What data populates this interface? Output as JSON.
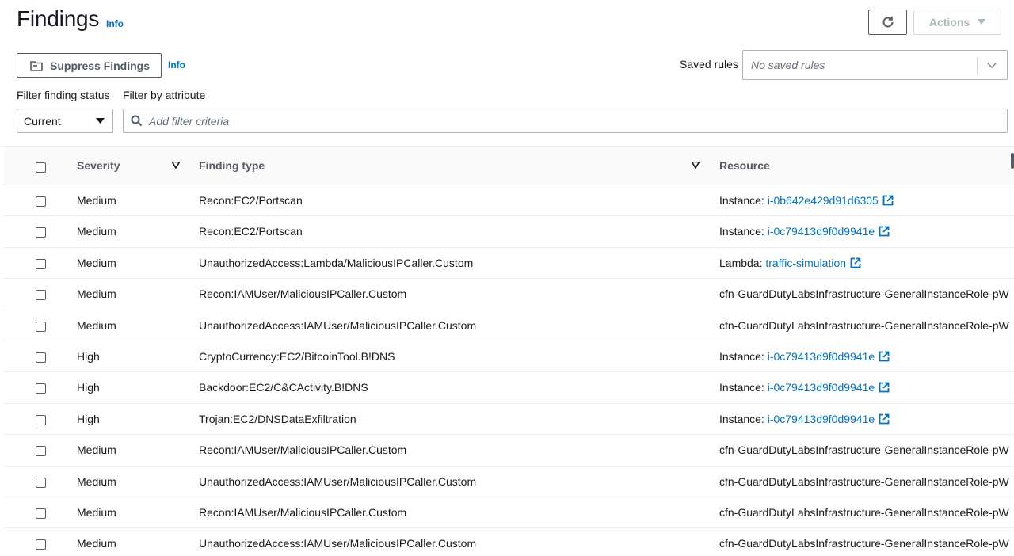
{
  "header": {
    "title": "Findings",
    "info_label": "Info",
    "actions_label": "Actions"
  },
  "toolbar": {
    "suppress_label": "Suppress Findings",
    "info_label": "Info",
    "saved_rules_label": "Saved rules",
    "saved_rules_placeholder": "No saved rules"
  },
  "filters": {
    "status_label": "Filter finding status",
    "attribute_label": "Filter by attribute",
    "status_value": "Current",
    "criteria_placeholder": "Add filter criteria"
  },
  "table": {
    "columns": [
      "Severity",
      "Finding type",
      "Resource"
    ],
    "rows": [
      {
        "severity": "Medium",
        "type": "Recon:EC2/Portscan",
        "res_prefix": "Instance: ",
        "res_link": "i-0b642e429d91d6305",
        "external": true
      },
      {
        "severity": "Medium",
        "type": "Recon:EC2/Portscan",
        "res_prefix": "Instance: ",
        "res_link": "i-0c79413d9f0d9941e",
        "external": true
      },
      {
        "severity": "Medium",
        "type": "UnauthorizedAccess:Lambda/MaliciousIPCaller.Custom",
        "res_prefix": "Lambda: ",
        "res_link": "traffic-simulation",
        "external": true
      },
      {
        "severity": "Medium",
        "type": "Recon:IAMUser/MaliciousIPCaller.Custom",
        "res_prefix": "cfn-GuardDutyLabsInfrastructure-GeneralInstanceRole-pW",
        "res_link": "",
        "external": false
      },
      {
        "severity": "Medium",
        "type": "UnauthorizedAccess:IAMUser/MaliciousIPCaller.Custom",
        "res_prefix": "cfn-GuardDutyLabsInfrastructure-GeneralInstanceRole-pW",
        "res_link": "",
        "external": false
      },
      {
        "severity": "High",
        "type": "CryptoCurrency:EC2/BitcoinTool.B!DNS",
        "res_prefix": "Instance: ",
        "res_link": "i-0c79413d9f0d9941e",
        "external": true
      },
      {
        "severity": "High",
        "type": "Backdoor:EC2/C&CActivity.B!DNS",
        "res_prefix": "Instance: ",
        "res_link": "i-0c79413d9f0d9941e",
        "external": true
      },
      {
        "severity": "High",
        "type": "Trojan:EC2/DNSDataExfiltration",
        "res_prefix": "Instance: ",
        "res_link": "i-0c79413d9f0d9941e",
        "external": true
      },
      {
        "severity": "Medium",
        "type": "Recon:IAMUser/MaliciousIPCaller.Custom",
        "res_prefix": "cfn-GuardDutyLabsInfrastructure-GeneralInstanceRole-pW",
        "res_link": "",
        "external": false
      },
      {
        "severity": "Medium",
        "type": "UnauthorizedAccess:IAMUser/MaliciousIPCaller.Custom",
        "res_prefix": "cfn-GuardDutyLabsInfrastructure-GeneralInstanceRole-pW",
        "res_link": "",
        "external": false
      },
      {
        "severity": "Medium",
        "type": "Recon:IAMUser/MaliciousIPCaller.Custom",
        "res_prefix": "cfn-GuardDutyLabsInfrastructure-GeneralInstanceRole-pW",
        "res_link": "",
        "external": false
      },
      {
        "severity": "Medium",
        "type": "UnauthorizedAccess:IAMUser/MaliciousIPCaller.Custom",
        "res_prefix": "cfn-GuardDutyLabsInfrastructure-GeneralInstanceRole-pW",
        "res_link": "",
        "external": false
      }
    ]
  },
  "colors": {
    "link": "#0073bb",
    "text": "#16191f",
    "header_text": "#545b64",
    "disabled": "#aab7b8"
  },
  "icons": [
    "refresh-icon",
    "caret-down-icon",
    "suppress-icon",
    "chevron-down-icon",
    "search-icon",
    "sort-caret-icon",
    "external-link-icon"
  ]
}
